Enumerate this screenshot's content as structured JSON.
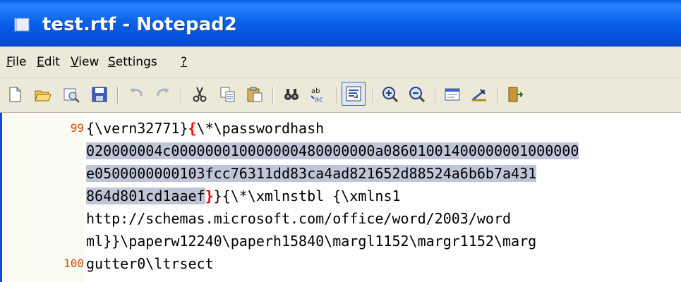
{
  "window": {
    "title": "test.rtf - Notepad2"
  },
  "menu": {
    "file": {
      "accel": "F",
      "rest": "ile"
    },
    "edit": {
      "accel": "E",
      "rest": "dit"
    },
    "view": {
      "accel": "V",
      "rest": "iew"
    },
    "settings": {
      "accel": "S",
      "rest": "ettings"
    },
    "help": {
      "accel": "?",
      "rest": ""
    }
  },
  "toolbar": {
    "icons": [
      "new-icon",
      "open-icon",
      "browse-icon",
      "save-icon",
      "undo-icon",
      "redo-icon",
      "cut-icon",
      "copy-icon",
      "paste-icon",
      "find-icon",
      "replace-icon",
      "word-wrap-icon",
      "zoom-in-icon",
      "zoom-out-icon",
      "settings-icon",
      "edit-scheme-icon",
      "exit-icon"
    ],
    "pressed": "word-wrap-icon"
  },
  "editor": {
    "line_numbers": {
      "first": "99",
      "second": "100"
    },
    "lines": {
      "l1_a": "{\\vern32771}",
      "l1_brace": "{",
      "l1_b": "\\*\\passwordhash",
      "l2": "020000004c000000010000000480000000a08601001400000001000000",
      "l3": "e0500000000103fcc76311dd83ca4ad821652d88524a6b6b7a431",
      "l4_sel": "864d801cd1aaef",
      "l4_brace": "}",
      "l4_rest": "}{\\*\\xmlnstbl {\\xmlns1",
      "l5": "http://schemas.microsoft.com/office/word/2003/word",
      "l6": "ml}}\\paperw12240\\paperh15840\\margl1152\\margr1152\\marg",
      "l7": "gutter0\\ltrsect"
    },
    "colors": {
      "selection": "#c0c6d8",
      "brace_match": "#ff0000",
      "line_number": "#d24a00"
    }
  }
}
